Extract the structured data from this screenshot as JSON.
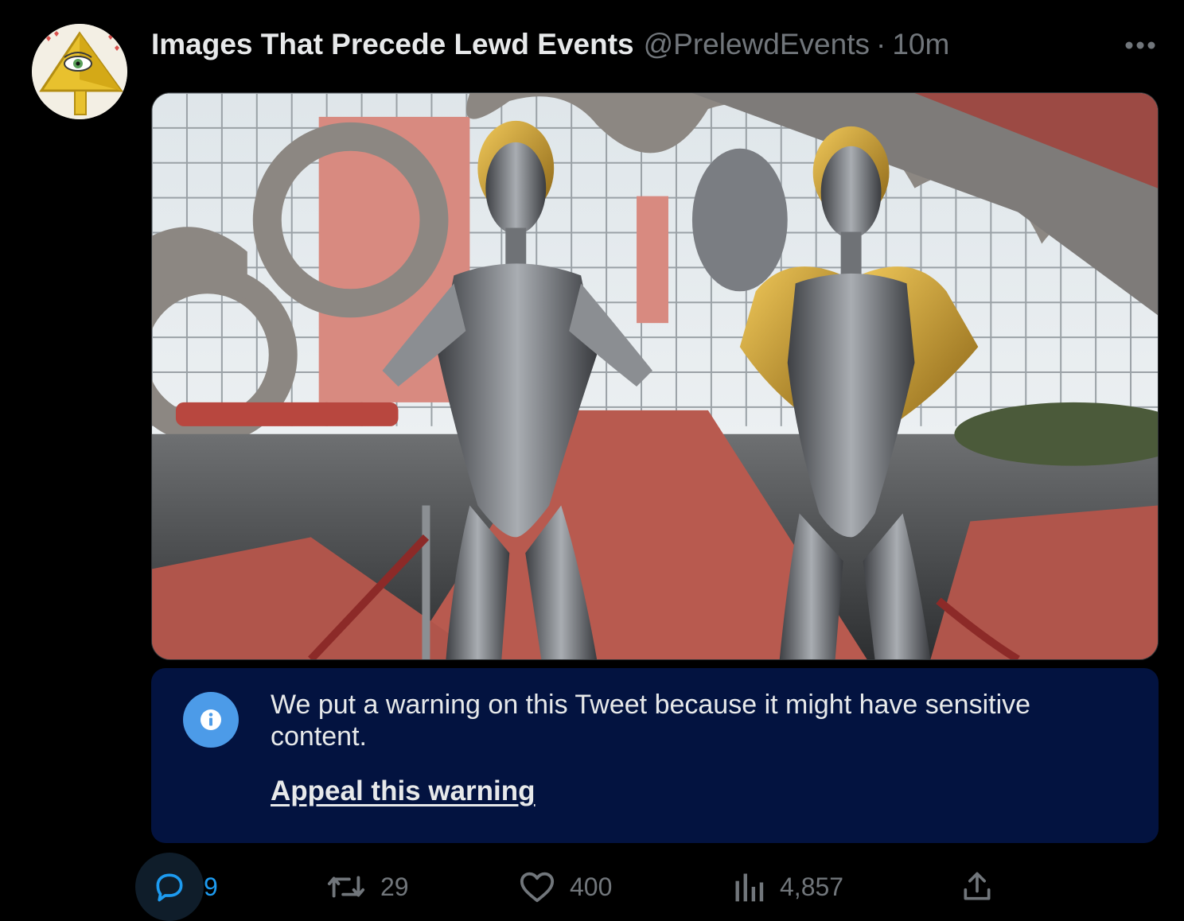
{
  "tweet": {
    "author": {
      "display_name": "Images That Precede Lewd Events",
      "handle": "@PrelewdEvents",
      "separator": "·",
      "time": "10m",
      "avatar_icon": "illuminati-pyramid-avatar"
    },
    "more_icon": "more-dots-icon",
    "media": {
      "description_icon": "game-screenshot-twin-robots"
    },
    "warning": {
      "icon": "info-icon",
      "text": "We put a warning on this Tweet because it might have sensitive content.",
      "link": "Appeal this warning",
      "background": "#031340"
    },
    "actions": {
      "reply": {
        "icon": "reply-icon",
        "count": "9"
      },
      "retweet": {
        "icon": "retweet-icon",
        "count": "29"
      },
      "like": {
        "icon": "heart-icon",
        "count": "400"
      },
      "views": {
        "icon": "views-icon",
        "count": "4,857"
      },
      "share": {
        "icon": "share-icon"
      }
    },
    "colors": {
      "accent": "#1d9bf0",
      "muted": "#71767b",
      "text": "#e7e9ea"
    }
  }
}
